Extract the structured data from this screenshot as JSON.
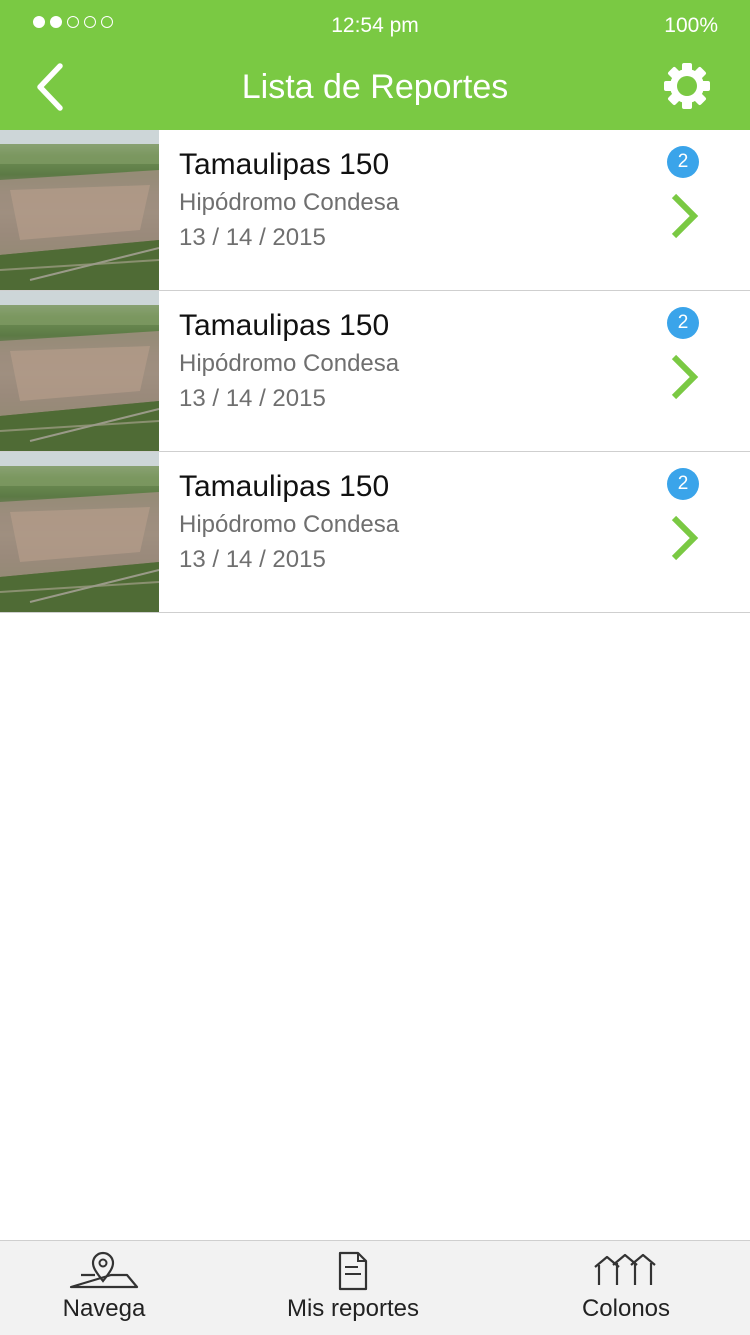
{
  "status": {
    "signal_dots": [
      "filled",
      "filled",
      "empty",
      "empty",
      "empty"
    ],
    "time": "12:54 pm",
    "battery": "100%"
  },
  "header": {
    "title": "Lista de Reportes",
    "back_icon": "chevron-left-icon",
    "settings_icon": "gear-icon",
    "color": "#7ac943"
  },
  "reports": [
    {
      "title": "Tamaulipas 150",
      "subtitle": "Hipódromo Condesa",
      "date": "13 / 14 / 2015",
      "count": "2"
    },
    {
      "title": "Tamaulipas 150",
      "subtitle": "Hipódromo Condesa",
      "date": "13 / 14 / 2015",
      "count": "2"
    },
    {
      "title": "Tamaulipas 150",
      "subtitle": "Hipódromo Condesa",
      "date": "13 / 14 / 2015",
      "count": "2"
    }
  ],
  "colors": {
    "accent": "#7ac943",
    "badge": "#3aa4ea"
  },
  "tabs": [
    {
      "label": "Navega",
      "icon": "map-pin-icon"
    },
    {
      "label": "Mis reportes",
      "icon": "document-icon"
    },
    {
      "label": "Colonos",
      "icon": "houses-icon"
    }
  ]
}
